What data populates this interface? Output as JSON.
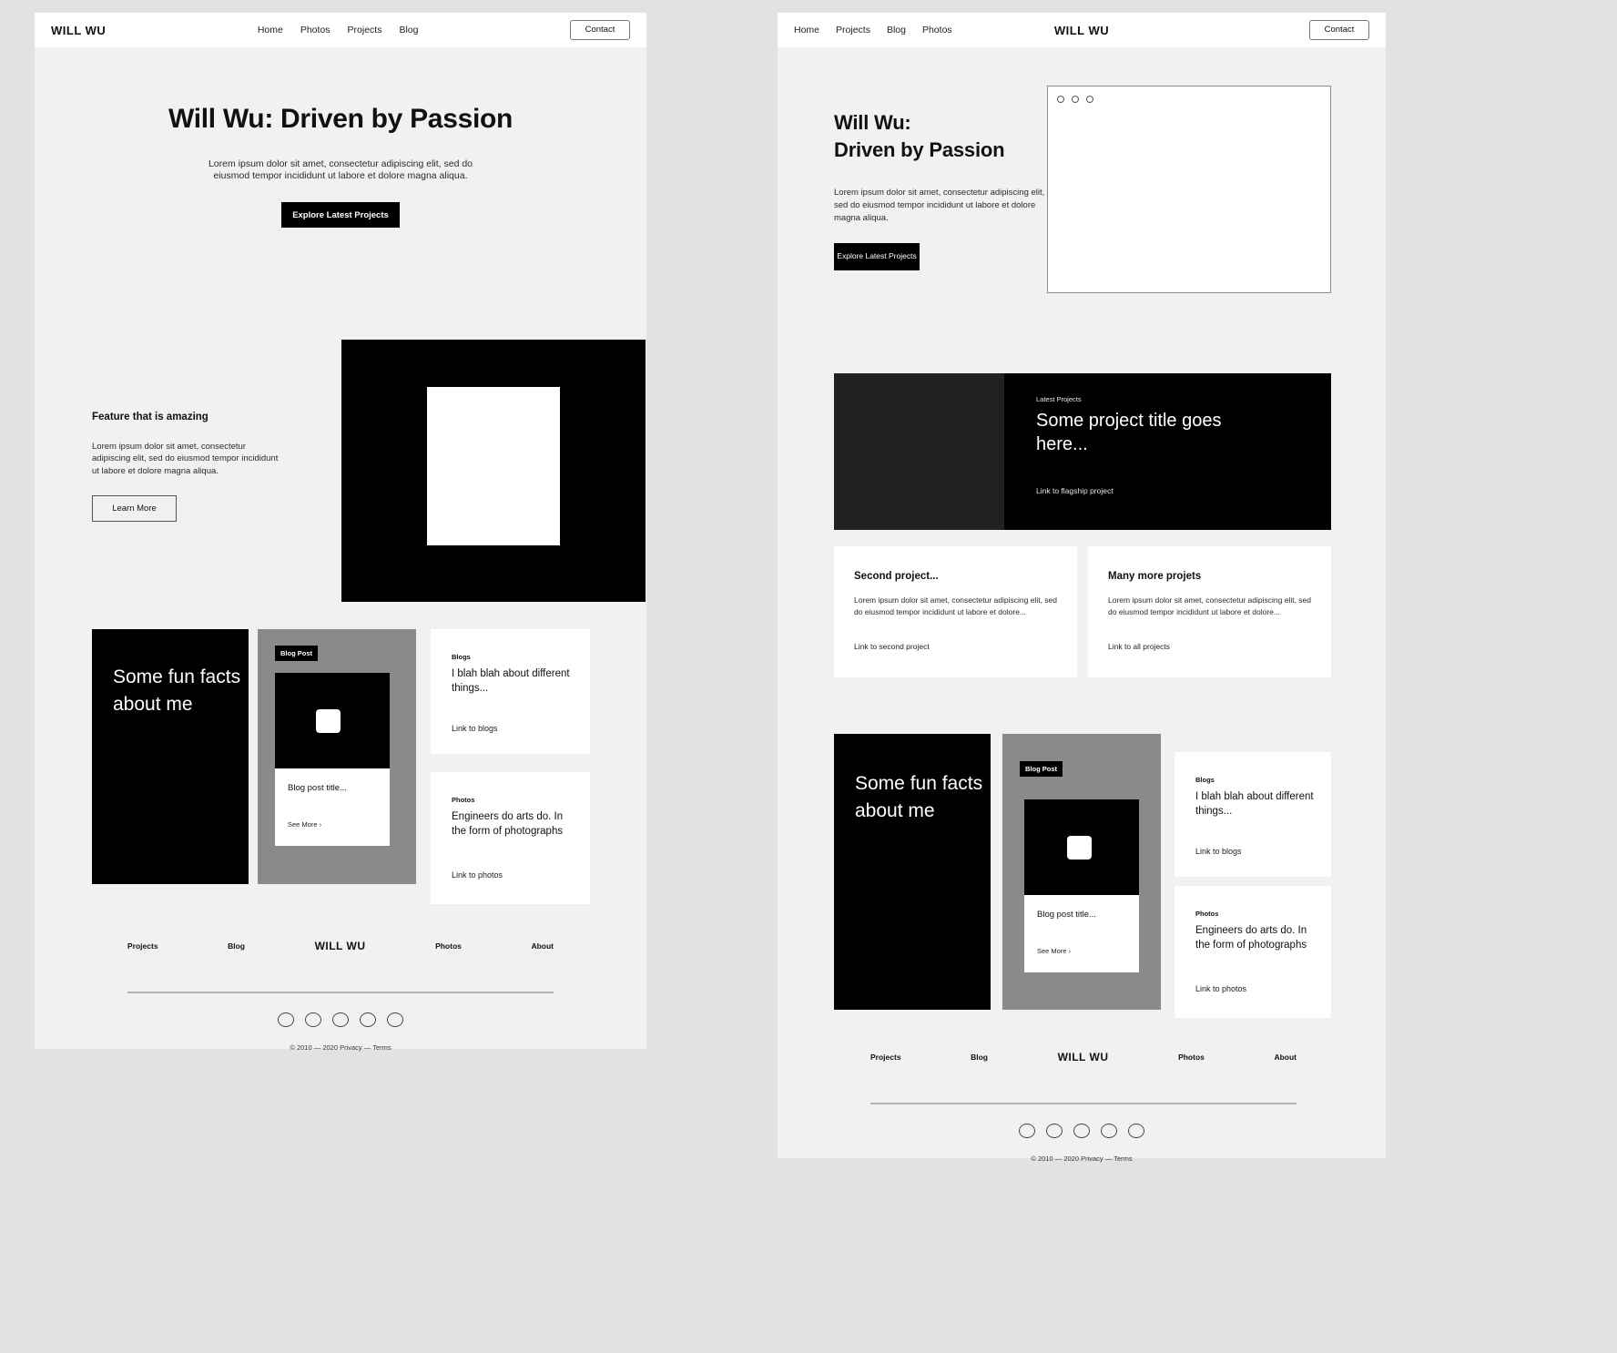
{
  "brand": "WILL WU",
  "contact_label": "Contact",
  "left": {
    "nav_links": [
      "Home",
      "Photos",
      "Projects",
      "Blog"
    ],
    "hero": {
      "title": "Will Wu: Driven by Passion",
      "body": "Lorem ipsum dolor sit amet, consectetur adipiscing elit, sed do eiusmod tempor incididunt ut labore et dolore magna aliqua.",
      "cta": "Explore Latest Projects"
    },
    "feature": {
      "title": "Feature that is amazing",
      "body": "Lorem ipsum dolor sit amet, consectetur adipiscing elit, sed do eiusmod tempor incididunt ut labore et dolore magna aliqua.",
      "cta": "Learn More"
    },
    "fun_facts": "Some fun facts about me",
    "blog_card": {
      "chip": "Blog Post",
      "title": "Blog post title...",
      "more": "See More ›"
    },
    "blogs_card": {
      "label": "Blogs",
      "headline": "I blah blah about different things...",
      "link": "Link to blogs"
    },
    "photos_card": {
      "label": "Photos",
      "headline": "Engineers do arts do. In the form of photographs",
      "link": "Link to photos"
    },
    "footer": {
      "links": [
        "Projects",
        "Blog",
        "Photos",
        "About"
      ],
      "copyright": "© 2010 — 2020   Privacy — Terms",
      "social_count": 5
    }
  },
  "right": {
    "nav_links": [
      "Home",
      "Projects",
      "Blog",
      "Photos"
    ],
    "hero": {
      "title_line1": "Will Wu:",
      "title_line2": "Driven by Passion",
      "body": "Lorem ipsum dolor sit amet, consectetur adipiscing elit, sed do eiusmod tempor incididunt ut labore et dolore magna aliqua.",
      "cta": "Explore Latest Projects"
    },
    "project_hero": {
      "label": "Latest Projects",
      "title": "Some project title goes here...",
      "link": "Link to flagship project"
    },
    "project_cards": [
      {
        "title": "Second project...",
        "body": "Lorem ipsum dolor sit amet, consectetur adipiscing elit, sed do eiusmod tempor incididunt ut labore et dolore...",
        "link": "Link to second project"
      },
      {
        "title": "Many more projets",
        "body": "Lorem ipsum dolor sit amet, consectetur adipiscing elit, sed do eiusmod tempor incididunt ut labore et dolore...",
        "link": "Link to all projects"
      }
    ],
    "fun_facts": "Some fun facts about me",
    "blog_card": {
      "chip": "Blog Post",
      "title": "Blog post title...",
      "more": "See More ›"
    },
    "blogs_card": {
      "label": "Blogs",
      "headline": "I blah blah about different things...",
      "link": "Link to blogs"
    },
    "photos_card": {
      "label": "Photos",
      "headline": "Engineers do arts do. In the form of photographs",
      "link": "Link to photos"
    },
    "footer": {
      "links": [
        "Projects",
        "Blog",
        "Photos",
        "About"
      ],
      "copyright": "© 2010 — 2020   Privacy — Terms",
      "social_count": 5
    }
  }
}
